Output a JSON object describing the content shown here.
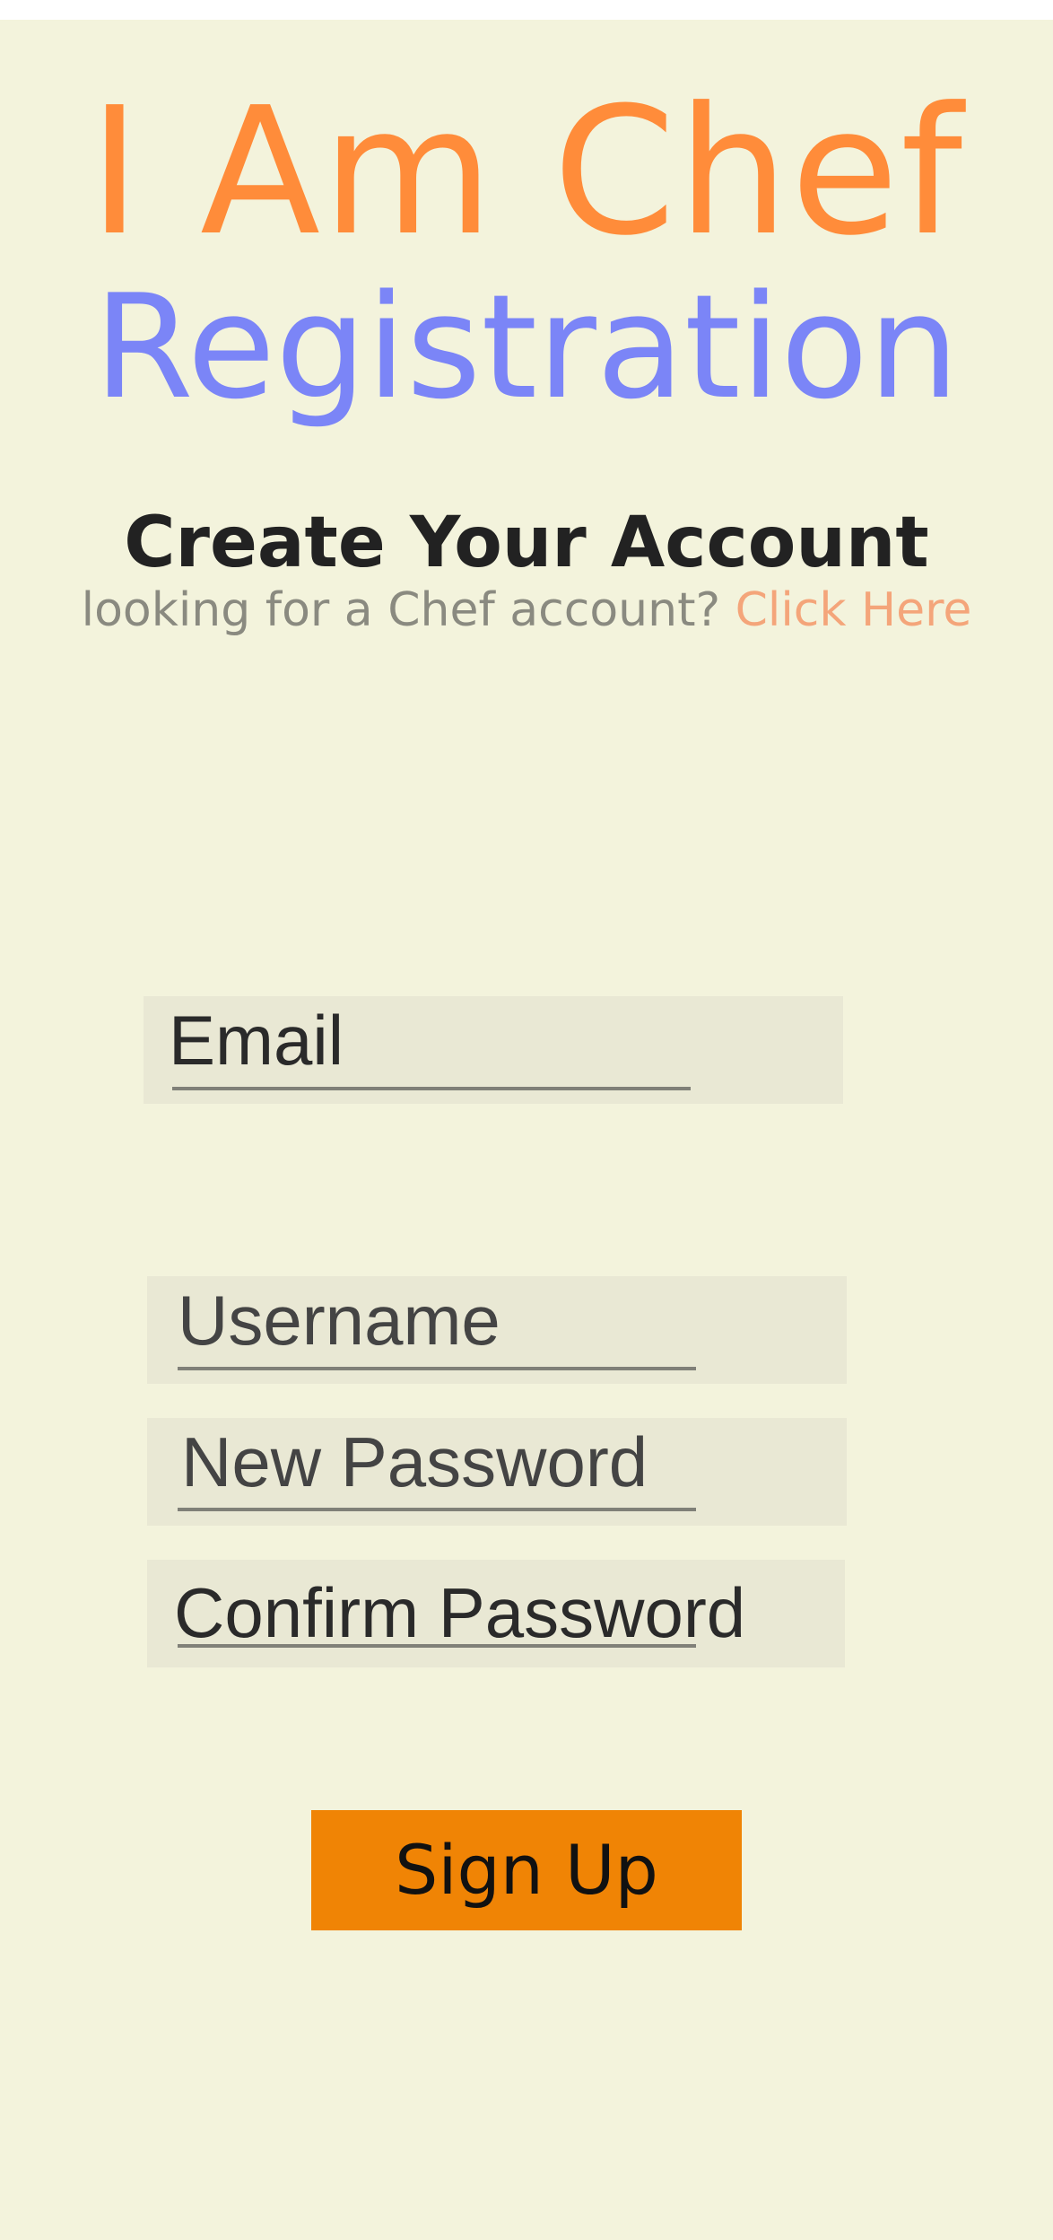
{
  "header": {
    "app_title": "I Am Chef",
    "page_title": "Registration"
  },
  "intro": {
    "heading": "Create Your Account",
    "prompt_text": "looking for a Chef account?",
    "link_text": "Click Here"
  },
  "form": {
    "email_placeholder": "Email",
    "username_placeholder": "Username",
    "new_password_placeholder": "New Password",
    "confirm_password_placeholder": "Confirm Password",
    "submit_label": "Sign Up"
  },
  "colors": {
    "background": "#f3f3dc",
    "title_orange": "#ff8c3a",
    "title_blue": "#7b85f7",
    "link": "#f4a57a",
    "button": "#f08405",
    "field_bg": "#e9e8d4"
  }
}
